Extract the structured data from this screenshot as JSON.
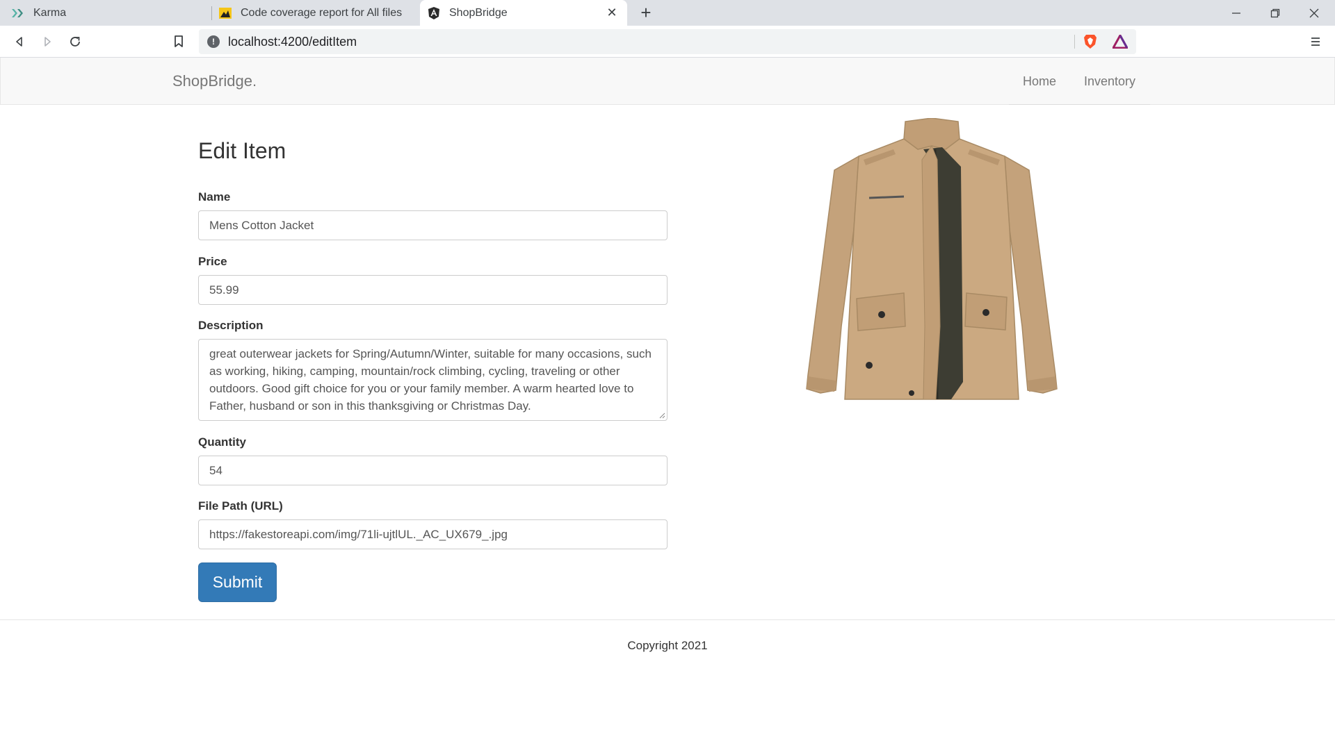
{
  "browser": {
    "tabs": [
      {
        "title": "Karma",
        "icon": "karma-icon",
        "active": false
      },
      {
        "title": "Code coverage report for All files",
        "icon": "istanbul-icon",
        "active": false
      },
      {
        "title": "ShopBridge",
        "icon": "angular-icon",
        "active": true
      }
    ],
    "url": "localhost:4200/editItem"
  },
  "navbar": {
    "brand": "ShopBridge.",
    "links": [
      {
        "label": "Home"
      },
      {
        "label": "Inventory"
      }
    ]
  },
  "form": {
    "title": "Edit Item",
    "name_label": "Name",
    "name_value": "Mens Cotton Jacket",
    "price_label": "Price",
    "price_value": "55.99",
    "description_label": "Description",
    "description_value": "great outerwear jackets for Spring/Autumn/Winter, suitable for many occasions, such as working, hiking, camping, mountain/rock climbing, cycling, traveling or other outdoors. Good gift choice for you or your family member. A warm hearted love to Father, husband or son in this thanksgiving or Christmas Day.",
    "quantity_label": "Quantity",
    "quantity_value": "54",
    "filepath_label": "File Path (URL)",
    "filepath_value": "https://fakestoreapi.com/img/71li-ujtlUL._AC_UX679_.jpg",
    "submit_label": "Submit"
  },
  "footer": {
    "copyright": "Copyright 2021"
  },
  "colors": {
    "primary": "#337ab7",
    "navbar_bg": "#f8f8f8",
    "jacket": "#c9a880"
  }
}
